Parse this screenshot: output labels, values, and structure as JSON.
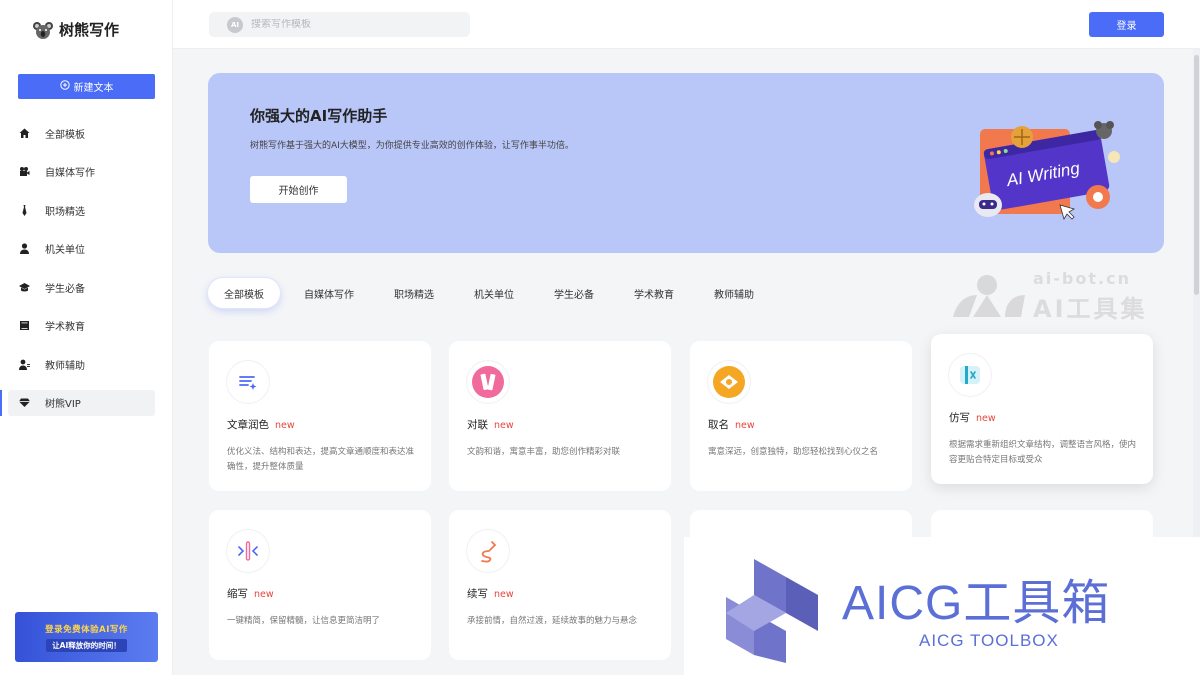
{
  "app": {
    "name": "树熊写作"
  },
  "sidebar": {
    "new_button": "新建文本",
    "items": [
      {
        "label": "全部模板",
        "icon": "home-icon"
      },
      {
        "label": "自媒体写作",
        "icon": "camera-icon"
      },
      {
        "label": "职场精选",
        "icon": "tie-icon"
      },
      {
        "label": "机关单位",
        "icon": "user-icon"
      },
      {
        "label": "学生必备",
        "icon": "graduation-cap-icon"
      },
      {
        "label": "学术教育",
        "icon": "book-icon"
      },
      {
        "label": "教师辅助",
        "icon": "teacher-icon"
      },
      {
        "label": "树熊VIP",
        "icon": "diamond-icon"
      }
    ],
    "promo": {
      "line1": "登录免费体验AI写作",
      "line2": "让AI释放你的时间！"
    }
  },
  "header": {
    "search_placeholder": "搜索写作模板",
    "search_badge": "AI",
    "login": "登录"
  },
  "hero": {
    "title": "你强大的AI写作助手",
    "subtitle": "树熊写作基于强大的AI大模型，为你提供专业高效的创作体验，让写作事半功倍。",
    "button": "开始创作",
    "art_text": "AI Writing"
  },
  "tabs": [
    "全部模板",
    "自媒体写作",
    "职场精选",
    "机关单位",
    "学生必备",
    "学术教育",
    "教师辅助"
  ],
  "cards": [
    {
      "title": "文章润色",
      "badge": "new",
      "desc": "优化义法、结构和表达，提高文章通顺度和表达准确性，提升整体质量",
      "icon": "polish-icon"
    },
    {
      "title": "对联",
      "badge": "new",
      "desc": "文韵和谐，寓意丰富，助您创作精彩对联",
      "icon": "couplet-icon"
    },
    {
      "title": "取名",
      "badge": "new",
      "desc": "寓意深远，创意独特，助您轻松找到心仪之名",
      "icon": "naming-icon"
    },
    {
      "title": "仿写",
      "badge": "new",
      "desc": "根据需求重新组织文章结构，调整语言风格，使内容更贴合特定目标或受众",
      "icon": "imitate-icon"
    },
    {
      "title": "缩写",
      "badge": "new",
      "desc": "一键精简，保留精髓，让信息更简洁明了",
      "icon": "abbreviate-icon"
    },
    {
      "title": "续写",
      "badge": "new",
      "desc": "承接前情，自然过渡，延续故事的魅力与悬念",
      "icon": "continue-icon"
    }
  ],
  "watermarks": {
    "aibot_url": "ai-bot.cn",
    "aibot_name": "AI工具集",
    "aicg_name": "AICG工具箱",
    "aicg_sub": "AICG TOOLBOX"
  },
  "colors": {
    "accent": "#4a6cf7",
    "hero_bg": "#b8c6f8",
    "new_badge": "#e8453c",
    "aicg": "#5b6fd6"
  }
}
